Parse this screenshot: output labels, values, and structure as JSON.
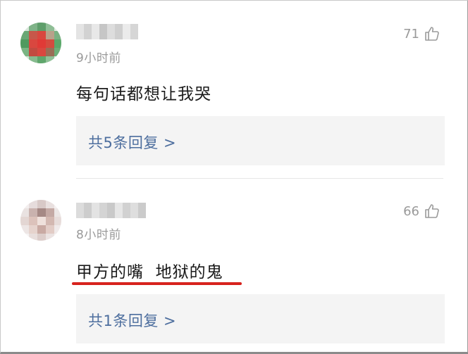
{
  "comments": [
    {
      "time": "9小时前",
      "likes": "71",
      "content": "每句话都想让我哭",
      "reply_link": "共5条回复 >",
      "colors": {
        "avatar_main": "#d9473f",
        "avatar_ring": "#5aa86a"
      }
    },
    {
      "time": "8小时前",
      "likes": "66",
      "content": "甲方的嘴  地狱的鬼",
      "reply_link": "共1条回复 >",
      "colors": {
        "avatar_main": "#e3d6d3",
        "underline": "#d7231e"
      }
    }
  ],
  "colors": {
    "link": "#4d6e9e",
    "muted": "#9a9a9a",
    "reply_bg": "#f4f4f4"
  },
  "icons": {
    "like": "thumbs-up-icon"
  }
}
